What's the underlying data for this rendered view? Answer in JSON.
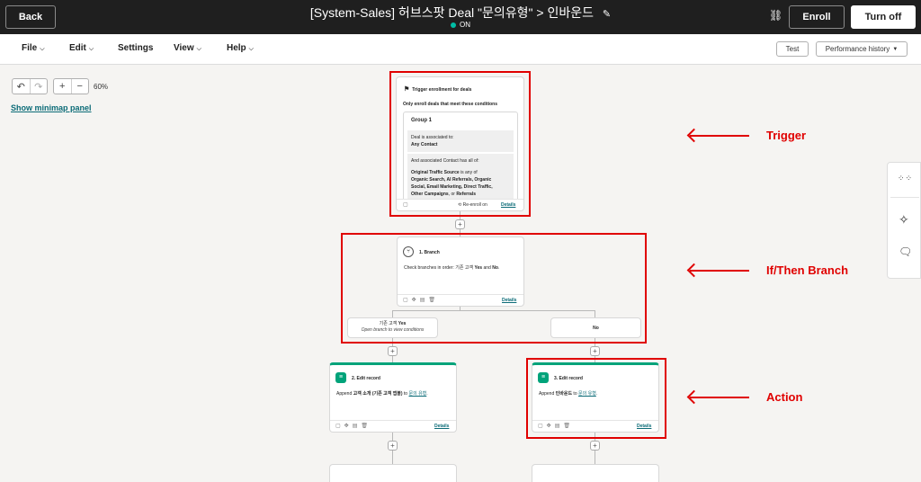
{
  "header": {
    "back_label": "Back",
    "title": "[System-Sales] 허브스팟 Deal \"문의유형\" > 인바운드",
    "status": "ON",
    "enroll_label": "Enroll",
    "turn_off_label": "Turn off"
  },
  "menu": {
    "items": [
      {
        "label": "File"
      },
      {
        "label": "Edit"
      },
      {
        "label": "Settings"
      },
      {
        "label": "View"
      },
      {
        "label": "Help"
      }
    ],
    "test_label": "Test",
    "history_label": "Performance history"
  },
  "canvas": {
    "zoom": "60%",
    "minimap_label": "Show minimap panel"
  },
  "trigger_card": {
    "title": "Trigger enrollment for deals",
    "subtitle": "Only enroll deals that meet these conditions",
    "group_title": "Group 1",
    "assoc_label": "Deal is associated to:",
    "assoc_value": "Any Contact",
    "and_label": "And associated Contact has all of:",
    "cond_line1": "Original Traffic Source",
    "cond_line1_rest": " is any of",
    "cond_line2": "Organic Search, AI Referrals, Organic",
    "cond_line3": "Social, Email Marketing, Direct Traffic,",
    "cond_line4": "Other Campaigns",
    "cond_line4_rest": ", or ",
    "cond_line4_end": "Referrals",
    "reenroll": "Re-enroll on",
    "details": "Details"
  },
  "branch_card": {
    "title": "1. Branch",
    "desc_prefix": "Check branches in order: ",
    "desc_korean": "기존 고객",
    "desc_yes": "Yes",
    "desc_and": " and ",
    "desc_no": "No",
    "details": "Details",
    "yes_branch_title_kr": "기존 고객",
    "yes_branch_title_yes": "Yes",
    "yes_branch_sub": "Open branch to view conditions",
    "no_branch": "No"
  },
  "action_left": {
    "title": "2. Edit record",
    "desc_prefix": "Append ",
    "desc_mid": "고객 소개 (기존 고객 앱볼)",
    "desc_to": " to ",
    "desc_prop": "문의 유형",
    "details": "Details"
  },
  "action_right": {
    "title": "3. Edit record",
    "desc_prefix": "Append ",
    "desc_mid": "인바운드",
    "desc_to": " to ",
    "desc_prop": "문의 유형",
    "details": "Details"
  },
  "annotations": {
    "trigger": "Trigger",
    "branch": "If/Then Branch",
    "action": "Action"
  },
  "colors": {
    "red": "#e00000",
    "green": "#00a37a",
    "status_dot": "#00bda5",
    "link": "#0b6b77"
  }
}
